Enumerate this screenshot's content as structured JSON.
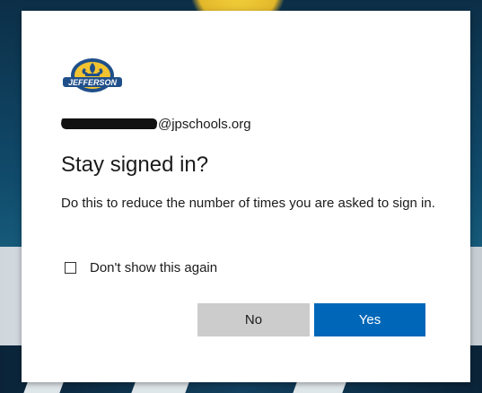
{
  "account": {
    "email_suffix": "@jpschools.org"
  },
  "logo": {
    "text": "JEFFERSON"
  },
  "dialog": {
    "title": "Stay signed in?",
    "description": "Do this to reduce the number of times you are asked to sign in.",
    "checkbox_label": "Don't show this again",
    "checkbox_checked": false,
    "no_label": "No",
    "yes_label": "Yes"
  },
  "colors": {
    "primary_button": "#0067b8",
    "secondary_button": "#cccccc",
    "text": "#1b1b1b"
  }
}
